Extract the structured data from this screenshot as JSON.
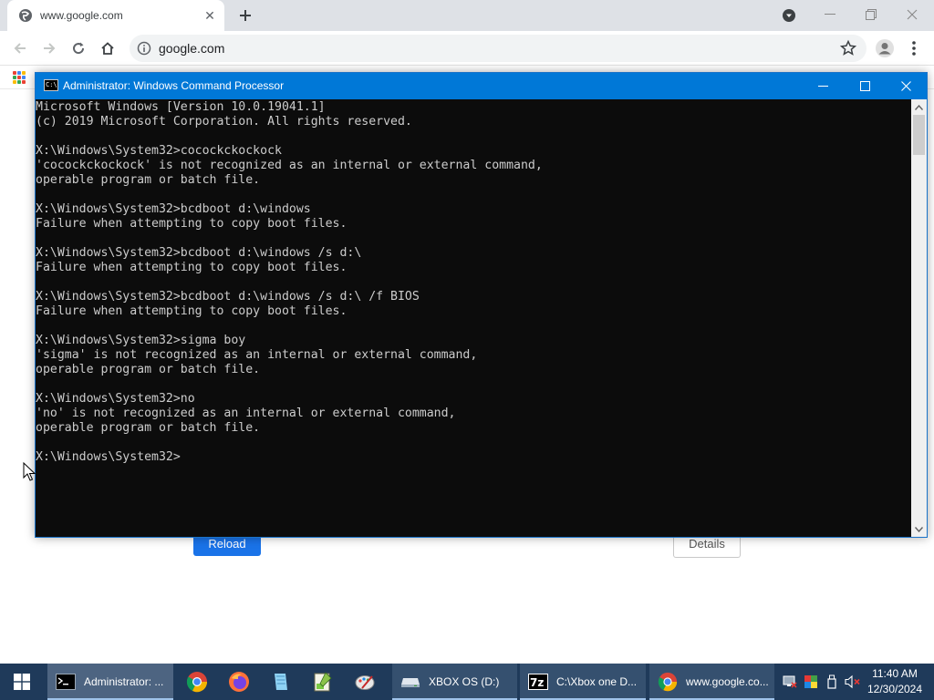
{
  "browser": {
    "tab_title": "www.google.com",
    "url": "google.com",
    "colors": {
      "tabstrip": "#dee1e6",
      "omnibox": "#f1f3f4",
      "accent": "#1a73e8"
    }
  },
  "page": {
    "reload_label": "Reload",
    "details_label": "Details"
  },
  "console": {
    "title": "Administrator: Windows Command Processor",
    "icon_text": "C:\\",
    "lines": [
      "Microsoft Windows [Version 10.0.19041.1]",
      "(c) 2019 Microsoft Corporation. All rights reserved.",
      "",
      "X:\\Windows\\System32>cocockckockock",
      "'cocockckockock' is not recognized as an internal or external command,",
      "operable program or batch file.",
      "",
      "X:\\Windows\\System32>bcdboot d:\\windows",
      "Failure when attempting to copy boot files.",
      "",
      "X:\\Windows\\System32>bcdboot d:\\windows /s d:\\",
      "Failure when attempting to copy boot files.",
      "",
      "X:\\Windows\\System32>bcdboot d:\\windows /s d:\\ /f BIOS",
      "Failure when attempting to copy boot files.",
      "",
      "X:\\Windows\\System32>sigma boy",
      "'sigma' is not recognized as an internal or external command,",
      "operable program or batch file.",
      "",
      "X:\\Windows\\System32>no",
      "'no' is not recognized as an internal or external command,",
      "operable program or batch file.",
      "",
      "X:\\Windows\\System32>"
    ],
    "colors": {
      "background": "#0c0c0c",
      "text": "#cccccc",
      "titlebar": "#0078d7"
    }
  },
  "taskbar": {
    "items": [
      {
        "label": "Administrator: ...",
        "icon": "cmd-icon",
        "state": "active"
      },
      {
        "label": "XBOX OS (D:)",
        "icon": "drive-icon",
        "state": "open"
      },
      {
        "label": "C:\\Xbox one D...",
        "icon": "7zip-icon",
        "state": "open"
      },
      {
        "label": "www.google.co...",
        "icon": "chrome-icon",
        "state": "open"
      }
    ],
    "pinned": [
      "chrome-icon",
      "firefox-icon",
      "notepad-icon",
      "notepadpp-icon",
      "paint-icon"
    ],
    "clock": {
      "time": "11:40 AM",
      "date": "12/30/2024"
    },
    "color": "#1f3a5a"
  }
}
